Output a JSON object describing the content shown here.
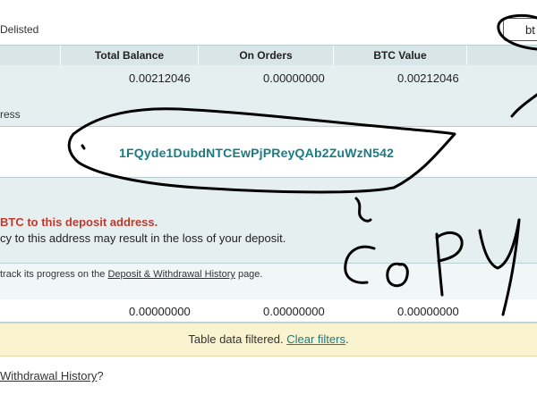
{
  "top": {
    "delisted_label": "Delisted",
    "search_value": "bt"
  },
  "table": {
    "headers": [
      "Total Balance",
      "On Orders",
      "BTC Value"
    ],
    "row": [
      "0.00212046",
      "0.00000000",
      "0.00212046"
    ]
  },
  "deposit": {
    "address_label": "ress",
    "address": "1FQyde1DubdNTCEwPjPReyQAb2ZuWzN542",
    "warning_red": "BTC to this deposit address.",
    "warning_black": "cy to this address may result in the loss of your deposit.",
    "track_prefix": "track its progress on the ",
    "track_link": "Deposit & Withdrawal History",
    "track_suffix": " page."
  },
  "summary_row": [
    "0.00000000",
    "0.00000000",
    "0.00000000"
  ],
  "filter": {
    "text": "Table data filtered. ",
    "clear_link": "Clear filters",
    "period": "."
  },
  "footer": {
    "link": "Withdrawal History",
    "suffix": "?"
  },
  "annotation": {
    "handwritten": "COPY"
  },
  "colors": {
    "accent": "#1b7b82",
    "warning": "#c0392b",
    "header_bg": "#d8e6e8",
    "filter_bg": "#faf3d0"
  }
}
